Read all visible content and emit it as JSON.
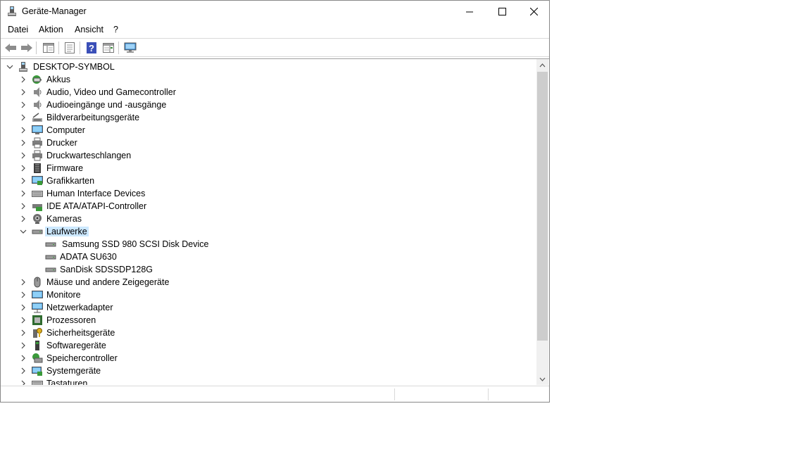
{
  "window": {
    "title": "Geräte-Manager"
  },
  "menu": {
    "items": [
      "Datei",
      "Aktion",
      "Ansicht",
      "?"
    ]
  },
  "toolbar": {
    "buttons": [
      "back-icon",
      "forward-icon",
      "show-hide-console-tree-icon",
      "properties-icon",
      "help-icon",
      "show-action-pane-icon",
      "scan-hardware-icon"
    ]
  },
  "tree": {
    "root": "DESKTOP-SYMBOL",
    "categories": [
      {
        "label": "Akkus",
        "icon": "battery-icon"
      },
      {
        "label": "Audio, Video und Gamecontroller",
        "icon": "speaker-icon"
      },
      {
        "label": "Audioeingänge und -ausgänge",
        "icon": "speaker-icon"
      },
      {
        "label": "Bildverarbeitungsgeräte",
        "icon": "scanner-icon"
      },
      {
        "label": "Computer",
        "icon": "computer-icon"
      },
      {
        "label": "Drucker",
        "icon": "printer-icon"
      },
      {
        "label": "Druckwarteschlangen",
        "icon": "printer-icon"
      },
      {
        "label": "Firmware",
        "icon": "firmware-icon"
      },
      {
        "label": "Grafikkarten",
        "icon": "display-adapter-icon"
      },
      {
        "label": "Human Interface Devices",
        "icon": "keyboard-icon"
      },
      {
        "label": "IDE ATA/ATAPI-Controller",
        "icon": "controller-icon"
      },
      {
        "label": "Kameras",
        "icon": "camera-icon"
      },
      {
        "label": "Laufwerke",
        "icon": "disk-drive-icon",
        "expanded": true,
        "selected": true,
        "children": [
          "Samsung SSD 980 SCSI Disk Device",
          "ADATA SU630",
          "SanDisk SDSSDP128G"
        ]
      },
      {
        "label": "Mäuse und andere Zeigegeräte",
        "icon": "mouse-icon"
      },
      {
        "label": "Monitore",
        "icon": "monitor-icon"
      },
      {
        "label": "Netzwerkadapter",
        "icon": "network-icon"
      },
      {
        "label": "Prozessoren",
        "icon": "processor-icon"
      },
      {
        "label": "Sicherheitsgeräte",
        "icon": "security-key-icon"
      },
      {
        "label": "Softwaregeräte",
        "icon": "software-device-icon"
      },
      {
        "label": "Speichercontroller",
        "icon": "storage-controller-icon"
      },
      {
        "label": "Systemgeräte",
        "icon": "system-devices-icon"
      },
      {
        "label": "Tastaturen",
        "icon": "keyboard-icon"
      }
    ]
  },
  "colors": {
    "selection": "#cce8ff",
    "accent": "#0078d7"
  }
}
